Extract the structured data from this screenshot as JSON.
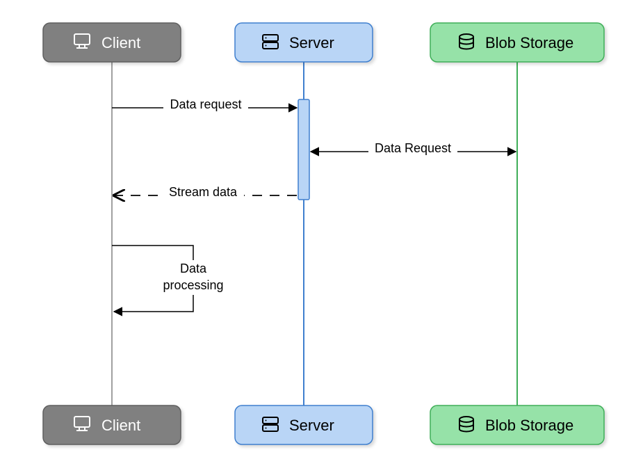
{
  "participants": {
    "client": {
      "label": "Client",
      "bg": "#808080",
      "border": "#5f5f5f",
      "text": "#ffffff",
      "line": "#808080",
      "icon": "monitor"
    },
    "server": {
      "label": "Server",
      "bg": "#b9d5f6",
      "border": "#3f7fce",
      "text": "#000000",
      "line": "#3f7fce",
      "icon": "disks"
    },
    "storage": {
      "label": "Blob Storage",
      "bg": "#96e2a8",
      "border": "#3fae58",
      "text": "#000000",
      "line": "#3fae58",
      "icon": "database"
    }
  },
  "messages": {
    "m1": {
      "label": "Data request"
    },
    "m2": {
      "label": "Data Request"
    },
    "m3": {
      "label": "Stream data"
    },
    "m4": {
      "label_line1": "Data",
      "label_line2": "processing"
    }
  }
}
